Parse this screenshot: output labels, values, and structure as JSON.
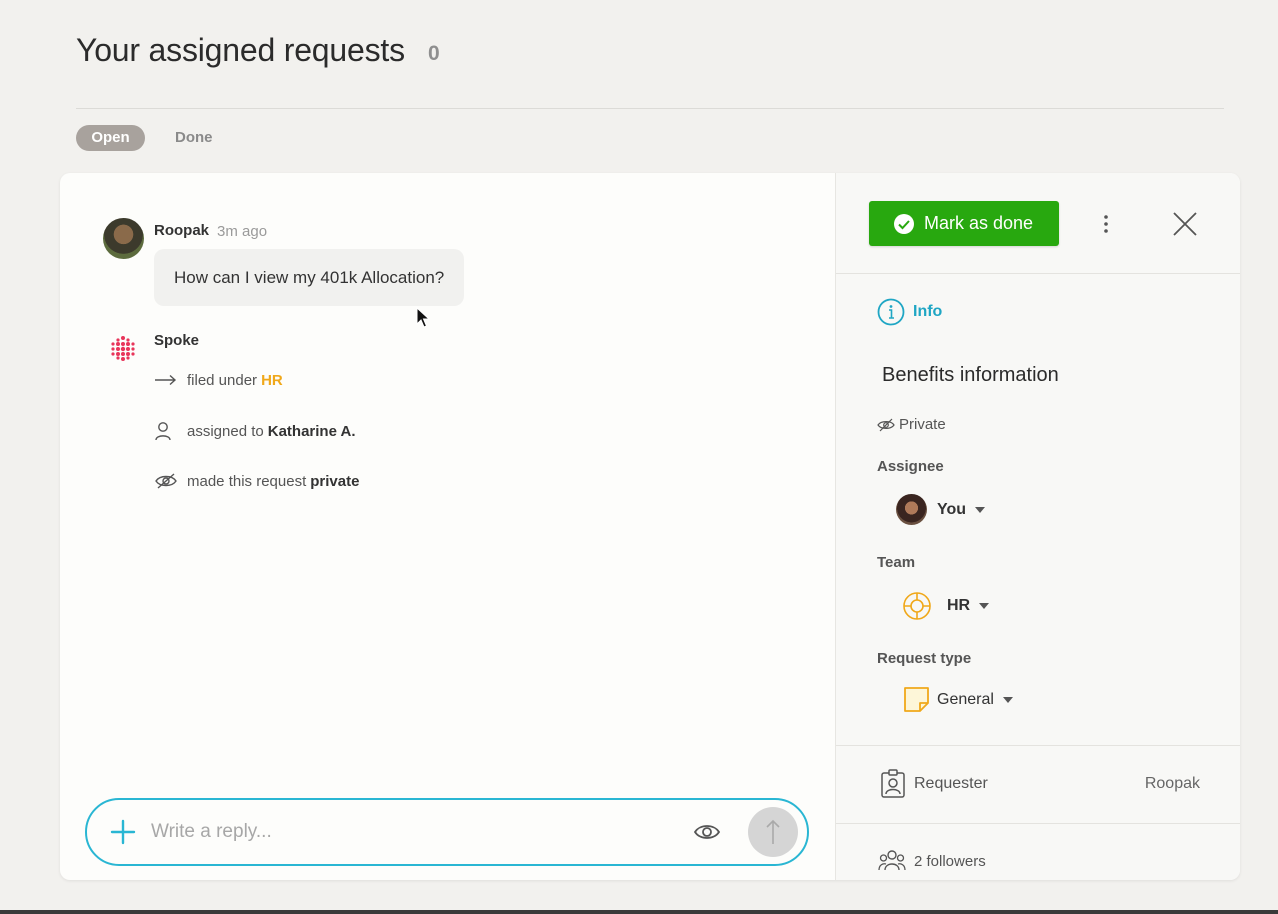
{
  "page": {
    "title": "Your assigned requests",
    "count": "0",
    "tabs": [
      {
        "label": "Open",
        "active": true
      },
      {
        "label": "Done",
        "active": false
      }
    ]
  },
  "conversation": {
    "message": {
      "author": "Roopak",
      "time": "3m ago",
      "text": "How can I view my 401k Allocation?"
    },
    "system": {
      "name": "Spoke",
      "activities": [
        {
          "icon": "arrow-right-icon",
          "prefix": "filed under",
          "value": "HR"
        },
        {
          "icon": "person-icon",
          "prefix": "assigned to",
          "value": "Katharine A."
        },
        {
          "icon": "eye-slash-icon",
          "prefix": "made this request",
          "value": "private"
        }
      ]
    },
    "reply": {
      "placeholder": "Write a reply..."
    }
  },
  "details": {
    "done_label": "Mark as done",
    "info_label": "Info",
    "request_title": "Benefits information",
    "visibility": "Private",
    "assignee_label": "Assignee",
    "assignee_value": "You",
    "team_label": "Team",
    "team_value": "HR",
    "type_label": "Request type",
    "type_value": "General",
    "requester_label": "Requester",
    "requester_value": "Roopak",
    "followers": "2 followers"
  },
  "colors": {
    "accent": "#29b6d3",
    "done_green": "#28a80f",
    "hr_orange": "#f0a81a",
    "spoke_red": "#e8355a"
  }
}
